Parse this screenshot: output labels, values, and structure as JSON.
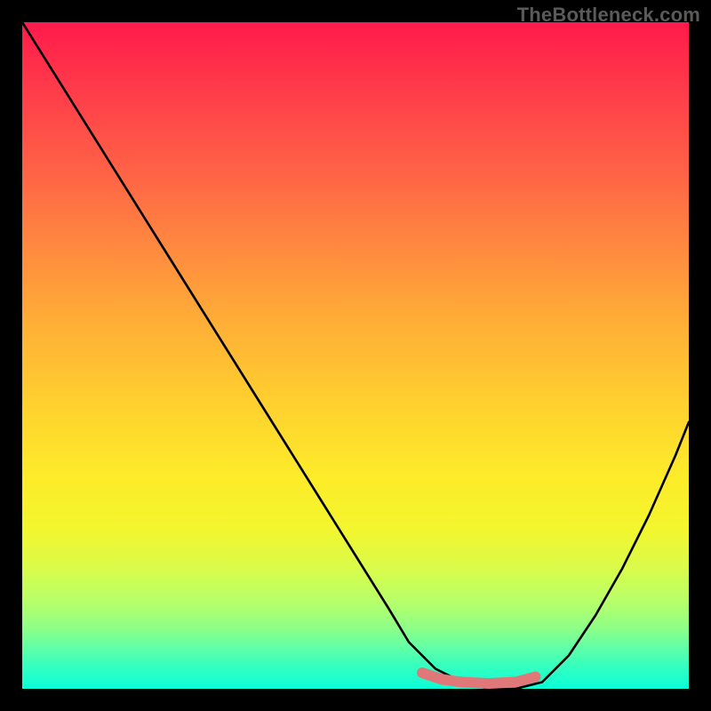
{
  "watermark": "TheBottleneck.com",
  "chart_data": {
    "type": "line",
    "title": "",
    "xlabel": "",
    "ylabel": "",
    "xlim": [
      0,
      100
    ],
    "ylim": [
      0,
      100
    ],
    "grid": false,
    "legend": false,
    "annotations": [],
    "series": [
      {
        "name": "black-curve",
        "x": [
          0,
          5,
          10,
          15,
          20,
          25,
          30,
          35,
          40,
          45,
          50,
          55,
          58,
          62,
          66,
          70,
          74,
          78,
          82,
          86,
          90,
          94,
          98,
          100
        ],
        "y": [
          100,
          92,
          84,
          76,
          68,
          60,
          52,
          44,
          36,
          28,
          20,
          12,
          7,
          3,
          1,
          0,
          0,
          1,
          5,
          11,
          18,
          26,
          35,
          40
        ],
        "color": "#000000"
      },
      {
        "name": "red-valley-highlight",
        "x": [
          60,
          63,
          66,
          70,
          74,
          77
        ],
        "y": [
          2.4,
          1.4,
          1.0,
          0.8,
          1.0,
          1.8
        ],
        "color": "#e0787a"
      }
    ],
    "gradient_background": {
      "direction": "vertical",
      "stops": [
        {
          "pos": 0.0,
          "color": "#ff1a4b"
        },
        {
          "pos": 0.22,
          "color": "#ff6146"
        },
        {
          "pos": 0.46,
          "color": "#ffb136"
        },
        {
          "pos": 0.68,
          "color": "#fdeb2a"
        },
        {
          "pos": 0.87,
          "color": "#b6ff6a"
        },
        {
          "pos": 1.0,
          "color": "#0affd7"
        }
      ]
    }
  }
}
